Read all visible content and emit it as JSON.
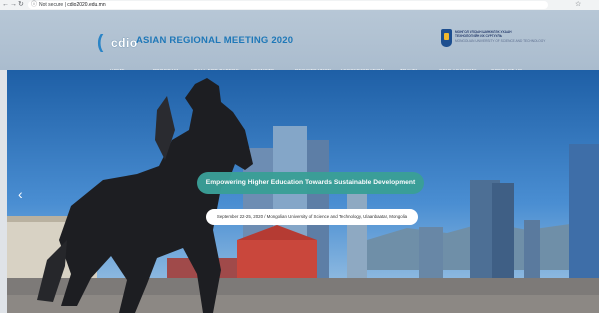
{
  "browser": {
    "back": "←",
    "forward": "→",
    "reload": "↻",
    "lock": "ⓘ",
    "security": "Not secure",
    "url_host": "cdio2020.edu.mn",
    "star": "☆"
  },
  "site": {
    "logo_text": "cdio",
    "title": "ASIAN REGIONAL MEETING 2020",
    "university_lines": [
      "МОНГОЛ УЛСЫН ШИНЖЛЭХ УХААН",
      "ТЕХНОЛОГИЙН ИХ СУРГУУЛЬ",
      "MONGOLIAN UNIVERSITY OF SCIENCE AND TECHNOLOGY"
    ]
  },
  "menu": [
    "HOME",
    "PROGRAM",
    "CALL FOR PAPERS",
    "KEYNOTE",
    "REGISTRATION",
    "ACCOMMODATION",
    "TRAVEL",
    "CDIO ACADEMY",
    "CONTACT US"
  ],
  "hero": {
    "prev_arrow": "‹",
    "headline": "Empowering Higher Education Towards Sustainable Development",
    "subline": "September 22-25, 2020 / Mongolian University of Science and Technology, Ulaanbaatar, Mongolia"
  },
  "colors": {
    "accent": "#1f78b8",
    "headline_bg": "#3a9f97",
    "header_bg": "#aabcce"
  }
}
